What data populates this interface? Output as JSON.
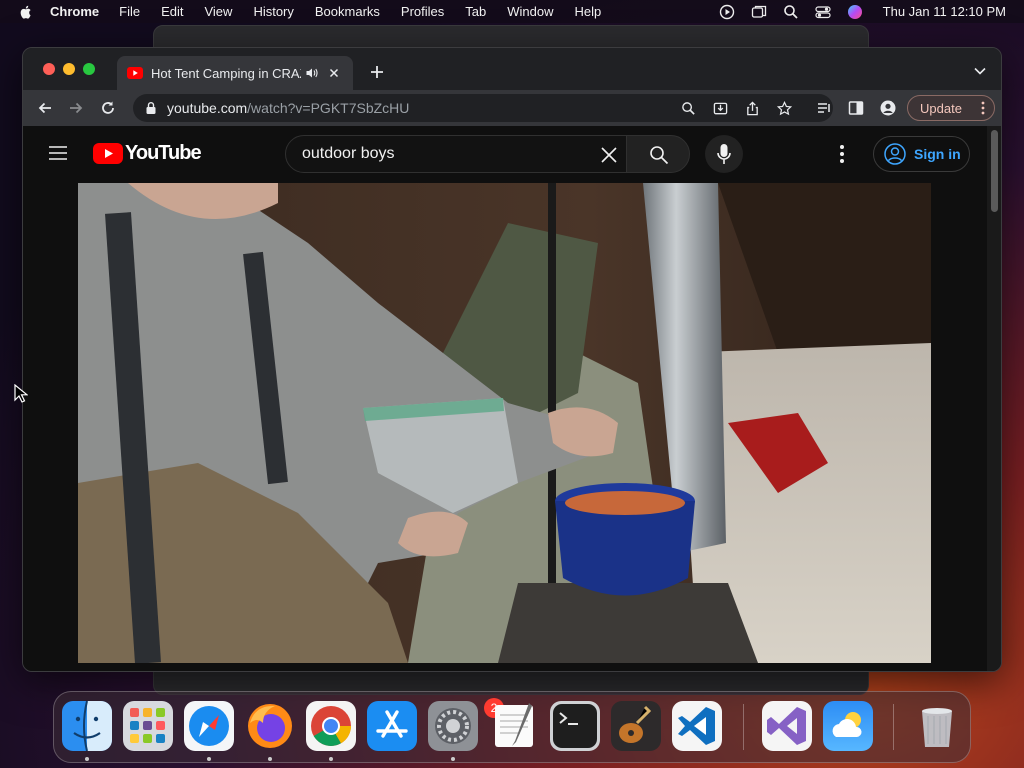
{
  "menubar": {
    "app_name": "Chrome",
    "menus": [
      "File",
      "Edit",
      "View",
      "History",
      "Bookmarks",
      "Profiles",
      "Tab",
      "Window",
      "Help"
    ],
    "clock": "Thu Jan 11  12:10 PM",
    "status_icons": [
      "play-circle-icon",
      "window-icon",
      "spotlight-search-icon",
      "control-center-icon",
      "siri-icon"
    ]
  },
  "browser": {
    "tab_title": "Hot Tent Camping in CRAZ",
    "url_host": "youtube.com",
    "url_path": "/watch?v=PGKT7SbZcHU",
    "update_label": "Update",
    "accent_color": "#f4c7bd"
  },
  "youtube": {
    "logo_text": "YouTube",
    "search_query": "outdoor boys",
    "sign_in_label": "Sign in",
    "brand_color": "#ff0000",
    "link_color": "#3ea6ff"
  },
  "dock": {
    "apps": [
      "Finder",
      "Launchpad",
      "Safari",
      "Firefox",
      "Google Chrome",
      "App Store",
      "System Settings",
      "TextEdit",
      "Terminal",
      "GarageBand",
      "Visual Studio Code",
      "Visual Studio",
      "Weather",
      "Trash"
    ],
    "system_settings_badge": "2"
  }
}
